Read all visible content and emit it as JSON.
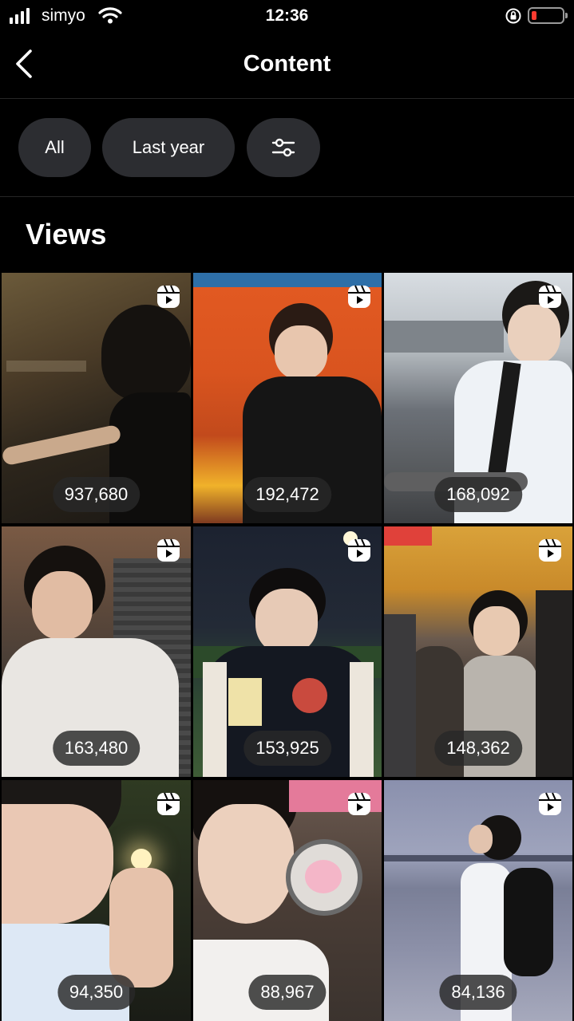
{
  "status_bar": {
    "carrier": "simyo",
    "time": "12:36",
    "battery_color": "#ff3b30",
    "icons": [
      "signal-icon",
      "wifi-icon",
      "rotation-lock-icon",
      "battery-icon"
    ]
  },
  "header": {
    "title": "Content",
    "back_icon": "chevron-left-icon"
  },
  "filters": {
    "all_label": "All",
    "period_label": "Last year",
    "settings_icon": "sliders-icon"
  },
  "section": {
    "title": "Views"
  },
  "reels": [
    {
      "views": "937,680"
    },
    {
      "views": "192,472"
    },
    {
      "views": "168,092"
    },
    {
      "views": "163,480"
    },
    {
      "views": "153,925"
    },
    {
      "views": "148,362"
    },
    {
      "views": "94,350"
    },
    {
      "views": "88,967"
    },
    {
      "views": "84,136"
    }
  ],
  "colors": {
    "background": "#000000",
    "chip_background": "#2c2d31",
    "divider": "#262626"
  }
}
